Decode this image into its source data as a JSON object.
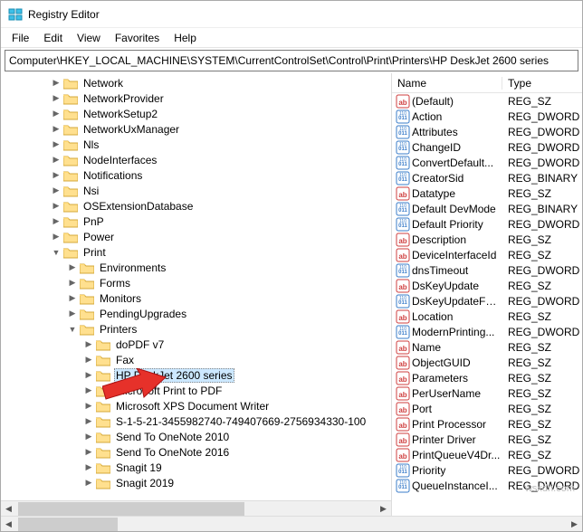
{
  "app": {
    "title": "Registry Editor"
  },
  "menu": {
    "items": [
      "File",
      "Edit",
      "View",
      "Favorites",
      "Help"
    ]
  },
  "address": {
    "path": "Computer\\HKEY_LOCAL_MACHINE\\SYSTEM\\CurrentControlSet\\Control\\Print\\Printers\\HP DeskJet 2600 series"
  },
  "tree": {
    "root_items": [
      "Network",
      "NetworkProvider",
      "NetworkSetup2",
      "NetworkUxManager",
      "Nls",
      "NodeInterfaces",
      "Notifications",
      "Nsi",
      "OSExtensionDatabase",
      "PnP",
      "Power"
    ],
    "print": {
      "label": "Print",
      "children": [
        "Environments",
        "Forms",
        "Monitors",
        "PendingUpgrades"
      ],
      "printers": {
        "label": "Printers",
        "children": [
          "doPDF v7",
          "Fax",
          "HP DeskJet 2600 series",
          "Microsoft Print to PDF",
          "Microsoft XPS Document Writer",
          "S-1-5-21-3455982740-749407669-2756934330-100",
          "Send To OneNote 2010",
          "Send To OneNote 2016",
          "Snagit 19",
          "Snagit 2019"
        ],
        "selected_index": 2
      }
    }
  },
  "values": {
    "columns": {
      "name": "Name",
      "type": "Type"
    },
    "rows": [
      {
        "icon": "str",
        "name": "(Default)",
        "type": "REG_SZ"
      },
      {
        "icon": "num",
        "name": "Action",
        "type": "REG_DWORD"
      },
      {
        "icon": "num",
        "name": "Attributes",
        "type": "REG_DWORD"
      },
      {
        "icon": "num",
        "name": "ChangeID",
        "type": "REG_DWORD"
      },
      {
        "icon": "num",
        "name": "ConvertDefault...",
        "type": "REG_DWORD"
      },
      {
        "icon": "bin",
        "name": "CreatorSid",
        "type": "REG_BINARY"
      },
      {
        "icon": "str",
        "name": "Datatype",
        "type": "REG_SZ"
      },
      {
        "icon": "bin",
        "name": "Default DevMode",
        "type": "REG_BINARY"
      },
      {
        "icon": "num",
        "name": "Default Priority",
        "type": "REG_DWORD"
      },
      {
        "icon": "str",
        "name": "Description",
        "type": "REG_SZ"
      },
      {
        "icon": "str",
        "name": "DeviceInterfaceId",
        "type": "REG_SZ"
      },
      {
        "icon": "num",
        "name": "dnsTimeout",
        "type": "REG_DWORD"
      },
      {
        "icon": "str",
        "name": "DsKeyUpdate",
        "type": "REG_SZ"
      },
      {
        "icon": "num",
        "name": "DsKeyUpdateFor...",
        "type": "REG_DWORD"
      },
      {
        "icon": "str",
        "name": "Location",
        "type": "REG_SZ"
      },
      {
        "icon": "num",
        "name": "ModernPrinting...",
        "type": "REG_DWORD"
      },
      {
        "icon": "str",
        "name": "Name",
        "type": "REG_SZ"
      },
      {
        "icon": "str",
        "name": "ObjectGUID",
        "type": "REG_SZ"
      },
      {
        "icon": "str",
        "name": "Parameters",
        "type": "REG_SZ"
      },
      {
        "icon": "str",
        "name": "PerUserName",
        "type": "REG_SZ"
      },
      {
        "icon": "str",
        "name": "Port",
        "type": "REG_SZ"
      },
      {
        "icon": "str",
        "name": "Print Processor",
        "type": "REG_SZ"
      },
      {
        "icon": "str",
        "name": "Printer Driver",
        "type": "REG_SZ"
      },
      {
        "icon": "str",
        "name": "PrintQueueV4Dr...",
        "type": "REG_SZ"
      },
      {
        "icon": "num",
        "name": "Priority",
        "type": "REG_DWORD"
      },
      {
        "icon": "num",
        "name": "QueueInstanceI...",
        "type": "REG_DWORD"
      }
    ]
  },
  "watermark": "wsxdn.com"
}
